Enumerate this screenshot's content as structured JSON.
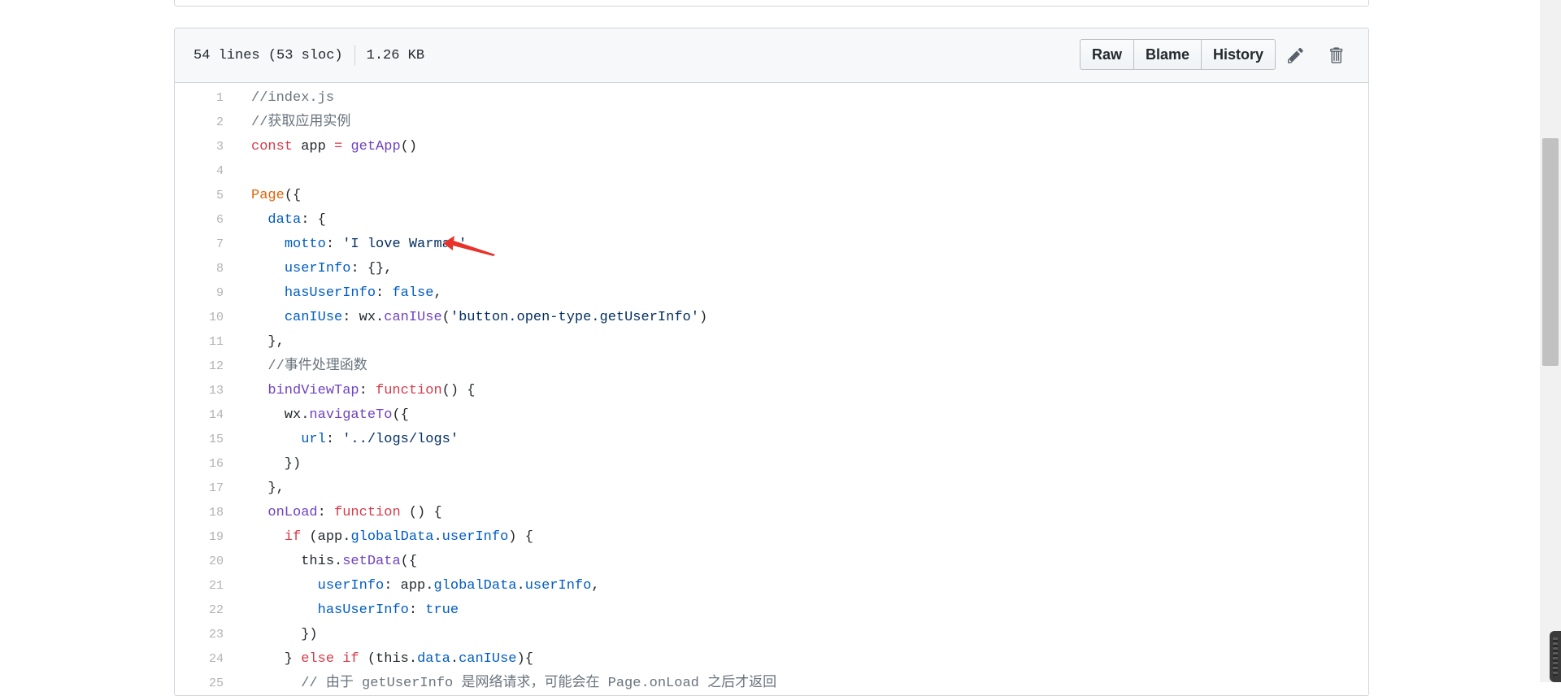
{
  "file_header": {
    "lines_info": "54 lines (53 sloc)",
    "size": "1.26 KB",
    "buttons": {
      "raw": "Raw",
      "blame": "Blame",
      "history": "History"
    },
    "edit_icon": "pencil-icon",
    "delete_icon": "trash-icon"
  },
  "code_lines": [
    {
      "n": "1",
      "t": [
        {
          "c": "c",
          "x": "//index.js"
        }
      ]
    },
    {
      "n": "2",
      "t": [
        {
          "c": "c",
          "x": "//获取应用实例"
        }
      ]
    },
    {
      "n": "3",
      "t": [
        {
          "c": "k",
          "x": "const"
        },
        {
          "c": "",
          "x": " app "
        },
        {
          "c": "k",
          "x": "="
        },
        {
          "c": "",
          "x": " "
        },
        {
          "c": "f",
          "x": "getApp"
        },
        {
          "c": "",
          "x": "()"
        }
      ]
    },
    {
      "n": "4",
      "t": []
    },
    {
      "n": "5",
      "t": [
        {
          "c": "e",
          "x": "Page"
        },
        {
          "c": "",
          "x": "({"
        }
      ]
    },
    {
      "n": "6",
      "t": [
        {
          "c": "",
          "x": "  "
        },
        {
          "c": "p",
          "x": "data"
        },
        {
          "c": "",
          "x": ": {"
        }
      ]
    },
    {
      "n": "7",
      "t": [
        {
          "c": "",
          "x": "    "
        },
        {
          "c": "p",
          "x": "motto"
        },
        {
          "c": "",
          "x": ": "
        },
        {
          "c": "s",
          "x": "'I love Warma '"
        }
      ]
    },
    {
      "n": "8",
      "t": [
        {
          "c": "",
          "x": "    "
        },
        {
          "c": "p",
          "x": "userInfo"
        },
        {
          "c": "",
          "x": ": {},"
        }
      ]
    },
    {
      "n": "9",
      "t": [
        {
          "c": "",
          "x": "    "
        },
        {
          "c": "p",
          "x": "hasUserInfo"
        },
        {
          "c": "",
          "x": ": "
        },
        {
          "c": "p",
          "x": "false"
        },
        {
          "c": "",
          "x": ","
        }
      ]
    },
    {
      "n": "10",
      "t": [
        {
          "c": "",
          "x": "    "
        },
        {
          "c": "p",
          "x": "canIUse"
        },
        {
          "c": "",
          "x": ": wx."
        },
        {
          "c": "f",
          "x": "canIUse"
        },
        {
          "c": "",
          "x": "("
        },
        {
          "c": "s",
          "x": "'button.open-type.getUserInfo'"
        },
        {
          "c": "",
          "x": ")"
        }
      ]
    },
    {
      "n": "11",
      "t": [
        {
          "c": "",
          "x": "  },"
        }
      ]
    },
    {
      "n": "12",
      "t": [
        {
          "c": "",
          "x": "  "
        },
        {
          "c": "c",
          "x": "//事件处理函数"
        }
      ]
    },
    {
      "n": "13",
      "t": [
        {
          "c": "",
          "x": "  "
        },
        {
          "c": "f",
          "x": "bindViewTap"
        },
        {
          "c": "",
          "x": ": "
        },
        {
          "c": "k",
          "x": "function"
        },
        {
          "c": "",
          "x": "() {"
        }
      ]
    },
    {
      "n": "14",
      "t": [
        {
          "c": "",
          "x": "    wx."
        },
        {
          "c": "f",
          "x": "navigateTo"
        },
        {
          "c": "",
          "x": "({"
        }
      ]
    },
    {
      "n": "15",
      "t": [
        {
          "c": "",
          "x": "      "
        },
        {
          "c": "p",
          "x": "url"
        },
        {
          "c": "",
          "x": ": "
        },
        {
          "c": "s",
          "x": "'../logs/logs'"
        }
      ]
    },
    {
      "n": "16",
      "t": [
        {
          "c": "",
          "x": "    })"
        }
      ]
    },
    {
      "n": "17",
      "t": [
        {
          "c": "",
          "x": "  },"
        }
      ]
    },
    {
      "n": "18",
      "t": [
        {
          "c": "",
          "x": "  "
        },
        {
          "c": "f",
          "x": "onLoad"
        },
        {
          "c": "",
          "x": ": "
        },
        {
          "c": "k",
          "x": "function"
        },
        {
          "c": "",
          "x": " () {"
        }
      ]
    },
    {
      "n": "19",
      "t": [
        {
          "c": "",
          "x": "    "
        },
        {
          "c": "k",
          "x": "if"
        },
        {
          "c": "",
          "x": " (app."
        },
        {
          "c": "p",
          "x": "globalData"
        },
        {
          "c": "",
          "x": "."
        },
        {
          "c": "p",
          "x": "userInfo"
        },
        {
          "c": "",
          "x": ") {"
        }
      ]
    },
    {
      "n": "20",
      "t": [
        {
          "c": "",
          "x": "      "
        },
        {
          "c": "",
          "x": "this"
        },
        {
          "c": "",
          "x": "."
        },
        {
          "c": "f",
          "x": "setData"
        },
        {
          "c": "",
          "x": "({"
        }
      ]
    },
    {
      "n": "21",
      "t": [
        {
          "c": "",
          "x": "        "
        },
        {
          "c": "p",
          "x": "userInfo"
        },
        {
          "c": "",
          "x": ": app."
        },
        {
          "c": "p",
          "x": "globalData"
        },
        {
          "c": "",
          "x": "."
        },
        {
          "c": "p",
          "x": "userInfo"
        },
        {
          "c": "",
          "x": ","
        }
      ]
    },
    {
      "n": "22",
      "t": [
        {
          "c": "",
          "x": "        "
        },
        {
          "c": "p",
          "x": "hasUserInfo"
        },
        {
          "c": "",
          "x": ": "
        },
        {
          "c": "p",
          "x": "true"
        }
      ]
    },
    {
      "n": "23",
      "t": [
        {
          "c": "",
          "x": "      })"
        }
      ]
    },
    {
      "n": "24",
      "t": [
        {
          "c": "",
          "x": "    } "
        },
        {
          "c": "k",
          "x": "else"
        },
        {
          "c": "",
          "x": " "
        },
        {
          "c": "k",
          "x": "if"
        },
        {
          "c": "",
          "x": " ("
        },
        {
          "c": "",
          "x": "this"
        },
        {
          "c": "",
          "x": "."
        },
        {
          "c": "p",
          "x": "data"
        },
        {
          "c": "",
          "x": "."
        },
        {
          "c": "p",
          "x": "canIUse"
        },
        {
          "c": "",
          "x": "){"
        }
      ]
    },
    {
      "n": "25",
      "t": [
        {
          "c": "",
          "x": "      "
        },
        {
          "c": "c",
          "x": "// 由于 getUserInfo 是网络请求，可能会在 Page.onLoad 之后才返回"
        }
      ]
    }
  ],
  "colors": {
    "comment": "#6a737d",
    "keyword": "#d73a49",
    "function": "#6f42c1",
    "property": "#005cc5",
    "string": "#032f62",
    "entity": "#e36209",
    "annotation_arrow": "#e8312a"
  }
}
